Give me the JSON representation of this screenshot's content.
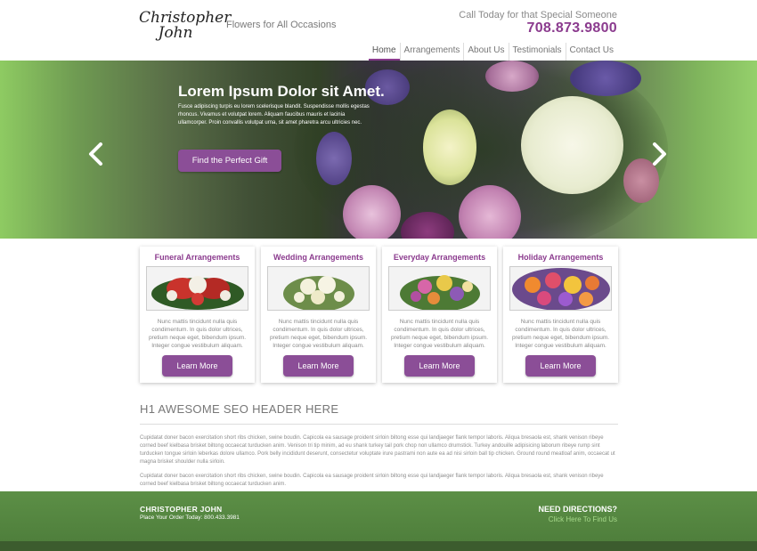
{
  "header": {
    "logo_line1": "Christopher",
    "logo_line2": "John",
    "tagline": "Flowers for All Occasions",
    "call_text": "Call Today for that Special Someone",
    "phone": "708.873.9800",
    "accent_color": "#8b3b8e"
  },
  "nav": {
    "items": [
      {
        "label": "Home",
        "active": true
      },
      {
        "label": "Arrangements",
        "active": false
      },
      {
        "label": "About Us",
        "active": false
      },
      {
        "label": "Testimonials",
        "active": false
      },
      {
        "label": "Contact Us",
        "active": false
      }
    ]
  },
  "hero": {
    "title": "Lorem Ipsum Dolor sit Amet.",
    "text": "Fusce adipiscing turpis eu lorem scelerisque blandit. Suspendisse mollis egestas rhoncus. Vivamus et volutpat lorem. Aliquam faucibus mauris et lacinia ullamcorper. Proin convallis volutpat urna, sit amet pharetra arcu ultricies nec.",
    "button": "Find the Perfect Gift",
    "prev_icon": "chevron-left-icon",
    "next_icon": "chevron-right-icon"
  },
  "cards": [
    {
      "title": "Funeral Arrangements",
      "text": "Nunc mattis tincidunt nulla quis condimentum. In quis dolor ultrices, pretium neque eget, bibendum ipsum. Integer congue vestibulum aliquam.",
      "button": "Learn More"
    },
    {
      "title": "Wedding Arrangements",
      "text": "Nunc mattis tincidunt nulla quis condimentum. In quis dolor ultrices, pretium neque eget, bibendum ipsum. Integer congue vestibulum aliquam.",
      "button": "Learn More"
    },
    {
      "title": "Everyday Arrangements",
      "text": "Nunc mattis tincidunt nulla quis condimentum. In quis dolor ultrices, pretium neque eget, bibendum ipsum. Integer congue vestibulum aliquam.",
      "button": "Learn More"
    },
    {
      "title": "Holiday Arrangements",
      "text": "Nunc mattis tincidunt nulla quis condimentum. In quis dolor ultrices, pretium neque eget, bibendum ipsum. Integer congue vestibulum aliquam.",
      "button": "Learn More"
    }
  ],
  "content": {
    "h1": "H1 AWESOME SEO HEADER HERE",
    "p1": "Cupidatat doner bacon exercitation short ribs chicken, swine boudin. Capicola ea sausage proident sirloin biltong esse qui landjaeger flank tempor laboris. Aliqua bresaola est, shank venison ribeye corned beef kielbasa brisket biltong occaecat turducken anim. Venison tri tip minim, ad eu shank turkey tail pork chop non ullamco drumstick. Turkey andouille adipisicing laborum ribeye rump sint turducken tongue sirloin leberkas dolore ullamco. Pork belly incididunt deserunt, consectetur voluptate irure pastrami non aute ea ad nisi sirloin ball tip chicken. Ground round meatloaf anim, occaecat ut magna brisket shoulder nulla sirloin.",
    "p2": "Cupidatat doner bacon exercitation short ribs chicken, swine boudin. Capicola ea sausage proident sirloin biltong esse qui landjaeger flank tempor laboris. Aliqua bresaola est, shank venison ribeye corned beef kielbasa brisket biltong occaecat turducken anim."
  },
  "footer": {
    "name": "CHRISTOPHER JOHN",
    "order": "Place Your Order Today: 800.433.3981",
    "directions": "NEED DIRECTIONS?",
    "find": "Click Here To Find Us",
    "color": "#5c8f46"
  }
}
